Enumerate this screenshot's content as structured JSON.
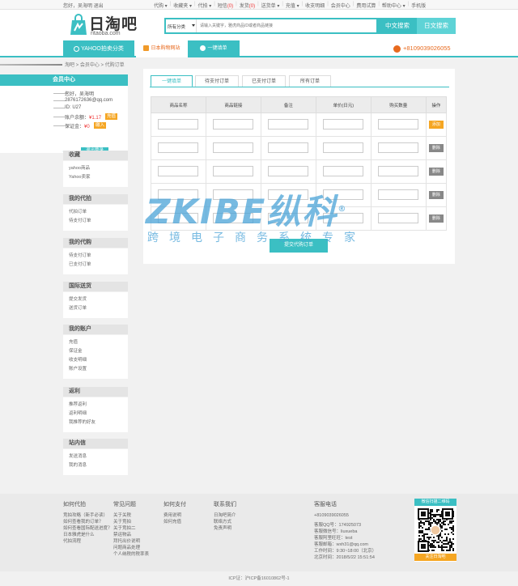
{
  "topbar": {
    "greeting": "您好，吴海明 退出",
    "links": [
      {
        "label": "代购",
        "caret": true
      },
      {
        "label": "收藏夹",
        "caret": true
      },
      {
        "label": "代拍",
        "caret": true
      },
      {
        "label": "短信",
        "count": "(0)"
      },
      {
        "label": "发货",
        "count": "(0)"
      },
      {
        "label": "送货单",
        "caret": true
      },
      {
        "label": "充值",
        "caret": true
      },
      {
        "label": "收支明细"
      },
      {
        "label": "会员中心"
      },
      {
        "label": "费用试算"
      },
      {
        "label": "帮助中心",
        "caret": true
      },
      {
        "label": "手机版"
      }
    ]
  },
  "header": {
    "logo_main": "日淘吧",
    "logo_sub": "ritaoba.com",
    "search_category": "所有分类",
    "search_placeholder": "请输入关键字，雅虎商品ID或者商品链接",
    "btn_cn": "中文搜索",
    "btn_jp": "日文搜索"
  },
  "nav": {
    "yahoo": "YAHOO拍卖分类",
    "jp_shop": "日本购物网站",
    "one_click": "一键填单",
    "phone": "+8109039026055"
  },
  "breadcrumb": "淘吧 > 会员中心 > 代购订单",
  "sidebar": {
    "title": "会员中心",
    "hello": "您好，吴海明",
    "email": "2876172636@qq.com",
    "id": "ID: U27",
    "balance_label": "账户余额：",
    "balance_value": "¥1.17",
    "balance_btn": "充值",
    "deposit_label": "保证金：",
    "deposit_value": "¥0",
    "deposit_btn": "缴入",
    "logout": "退出登录",
    "sections": [
      {
        "title": "收藏",
        "items": [
          "yahoo商品",
          "Yahoo卖家"
        ]
      },
      {
        "title": "我的代拍",
        "items": [
          "代拍订单",
          "待支付订单"
        ]
      },
      {
        "title": "我的代购",
        "items": [
          "待支付订单",
          "已支付订单"
        ]
      },
      {
        "title": "国际送货",
        "items": [
          "提交发货",
          "送货订单"
        ]
      },
      {
        "title": "我的账户",
        "items": [
          "充值",
          "保证金",
          "收支明细",
          "账户设置"
        ]
      },
      {
        "title": "返利",
        "items": [
          "推荐返利",
          "返利明细",
          "我推荐的好友"
        ]
      },
      {
        "title": "站内信",
        "items": [
          "发送消息",
          "我的消息"
        ]
      }
    ]
  },
  "main": {
    "tabs": [
      "一键填单",
      "待支付订单",
      "已支付订单",
      "所有订单"
    ],
    "columns": [
      "商品名称",
      "商品链接",
      "备注",
      "单价(日元)",
      "购买数量",
      "操作"
    ],
    "add_label": "添加",
    "delete_label": "删除",
    "submit": "提交代购订单"
  },
  "watermark": {
    "brand": "ZKIBE纵科",
    "reg": "®",
    "tagline": "跨境电子商务系统专家"
  },
  "footer": {
    "cols": [
      {
        "title": "如何代拍",
        "items": [
          "竞拍攻略（新手必读）",
          "如何查看我的订单？",
          "如何查看国际配送进度？",
          "日本雅虎是什么",
          "代拍流程"
        ]
      },
      {
        "title": "常见问题",
        "items": [
          "关于关税",
          "关于竞拍",
          "关于竞拍二",
          "禁运物品",
          "拜托出价说明",
          "问题商品处理",
          "个人纳税的税率表"
        ]
      },
      {
        "title": "如何支付",
        "items": [
          "费用说明",
          "如何充值"
        ]
      },
      {
        "title": "联系我们",
        "items": [
          "日淘吧简介",
          "联络方式",
          "免责声明"
        ]
      },
      {
        "title": "客服电话",
        "items": [
          "+8109039026055",
          "",
          "客服QQ号：174925073",
          "客服微信号：liuxueba",
          "客服阿里旺旺：test",
          "客服邮箱：wxh31@qq.com",
          "工作时间：9:30~18:00（北京）",
          "北京时间：2018/5/22 15:51:54"
        ]
      }
    ],
    "qr_title": "微信扫描二维码",
    "qr_follow": "关注日淘吧",
    "icp": "ICP证：沪ICP备16010862号-1"
  },
  "colors": {
    "accent": "#3bbfc3",
    "orange": "#f5a623",
    "phone": "#e86a1e"
  }
}
